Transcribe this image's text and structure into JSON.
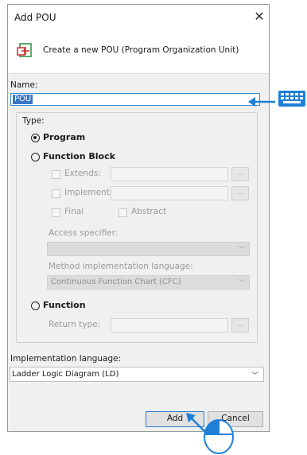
{
  "dialog": {
    "title": "Add POU",
    "close_glyph": "✕",
    "header_text": "Create a new POU (Program Organization Unit)",
    "name_label": "Name:",
    "name_value": "POU",
    "type_label": "Type:",
    "types": {
      "program": "Program",
      "function_block": "Function Block",
      "function": "Function"
    },
    "fb_options": {
      "extends": "Extends:",
      "implements": "Implements:",
      "final": "Final",
      "abstract": "Abstract",
      "access_specifier": "Access specifier:",
      "method_impl_lang": "Method implementation language:",
      "method_impl_value": "Continuous Function Chart (CFC)",
      "ellipsis": "..."
    },
    "return_type_label": "Return type:",
    "impl_lang_label": "Implementation language:",
    "impl_lang_value": "Ladder Logic Diagram (LD)",
    "add_label": "Add",
    "cancel_label": "Cancel",
    "selected_type": "program"
  },
  "colors": {
    "accent": "#2b78d0",
    "selection": "#3877c5",
    "annotation": "#1e7fd6"
  },
  "icons": {
    "pou": "pou-icon",
    "keyboard": "keyboard-icon",
    "mouse": "mouse-icon"
  }
}
